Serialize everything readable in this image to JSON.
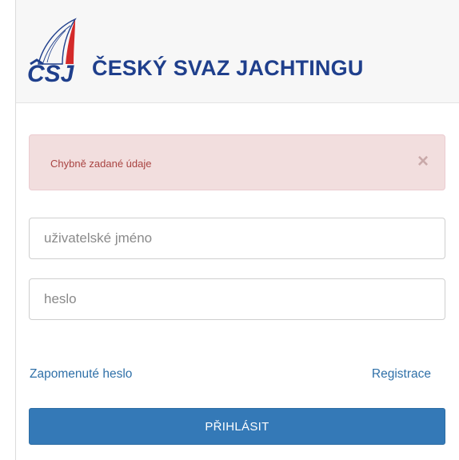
{
  "brand": {
    "logo_letters": "ČSJ",
    "name": "ČESKÝ SVAZ JACHTINGU",
    "color_primary": "#1f3f8c",
    "color_accent": "#d42a2a"
  },
  "alert": {
    "message": "Chybně zadané údaje",
    "close_symbol": "×"
  },
  "form": {
    "username_placeholder": "uživatelské jméno",
    "password_placeholder": "heslo",
    "forgot_password_link": "Zapomenuté heslo",
    "register_link": "Registrace",
    "submit_label": "PŘIHLÁSIT"
  }
}
